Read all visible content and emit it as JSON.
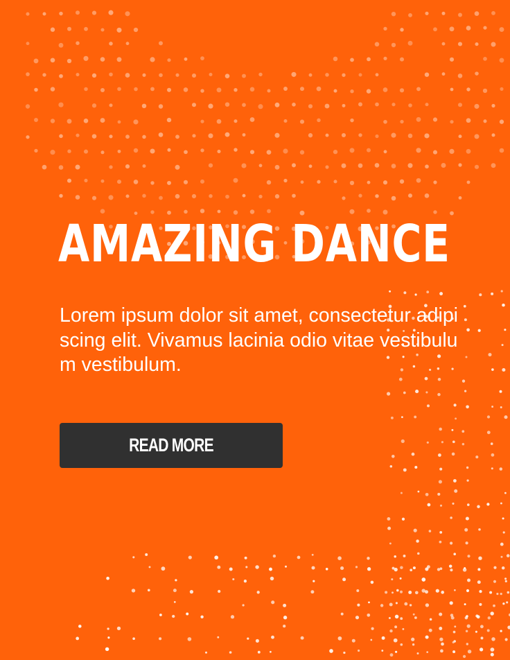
{
  "hero": {
    "title": "AMAZING DANCE",
    "description": "Lorem ipsum dolor sit amet, consectetur adipiscing elit. Vivamus lacinia odio vitae vestibulum vestibulum.",
    "button_label": "READ MORE"
  },
  "colors": {
    "background": "#ff620a",
    "button": "#303030",
    "text": "#ffffff",
    "dots": "rgba(255,255,255,0.35)"
  }
}
